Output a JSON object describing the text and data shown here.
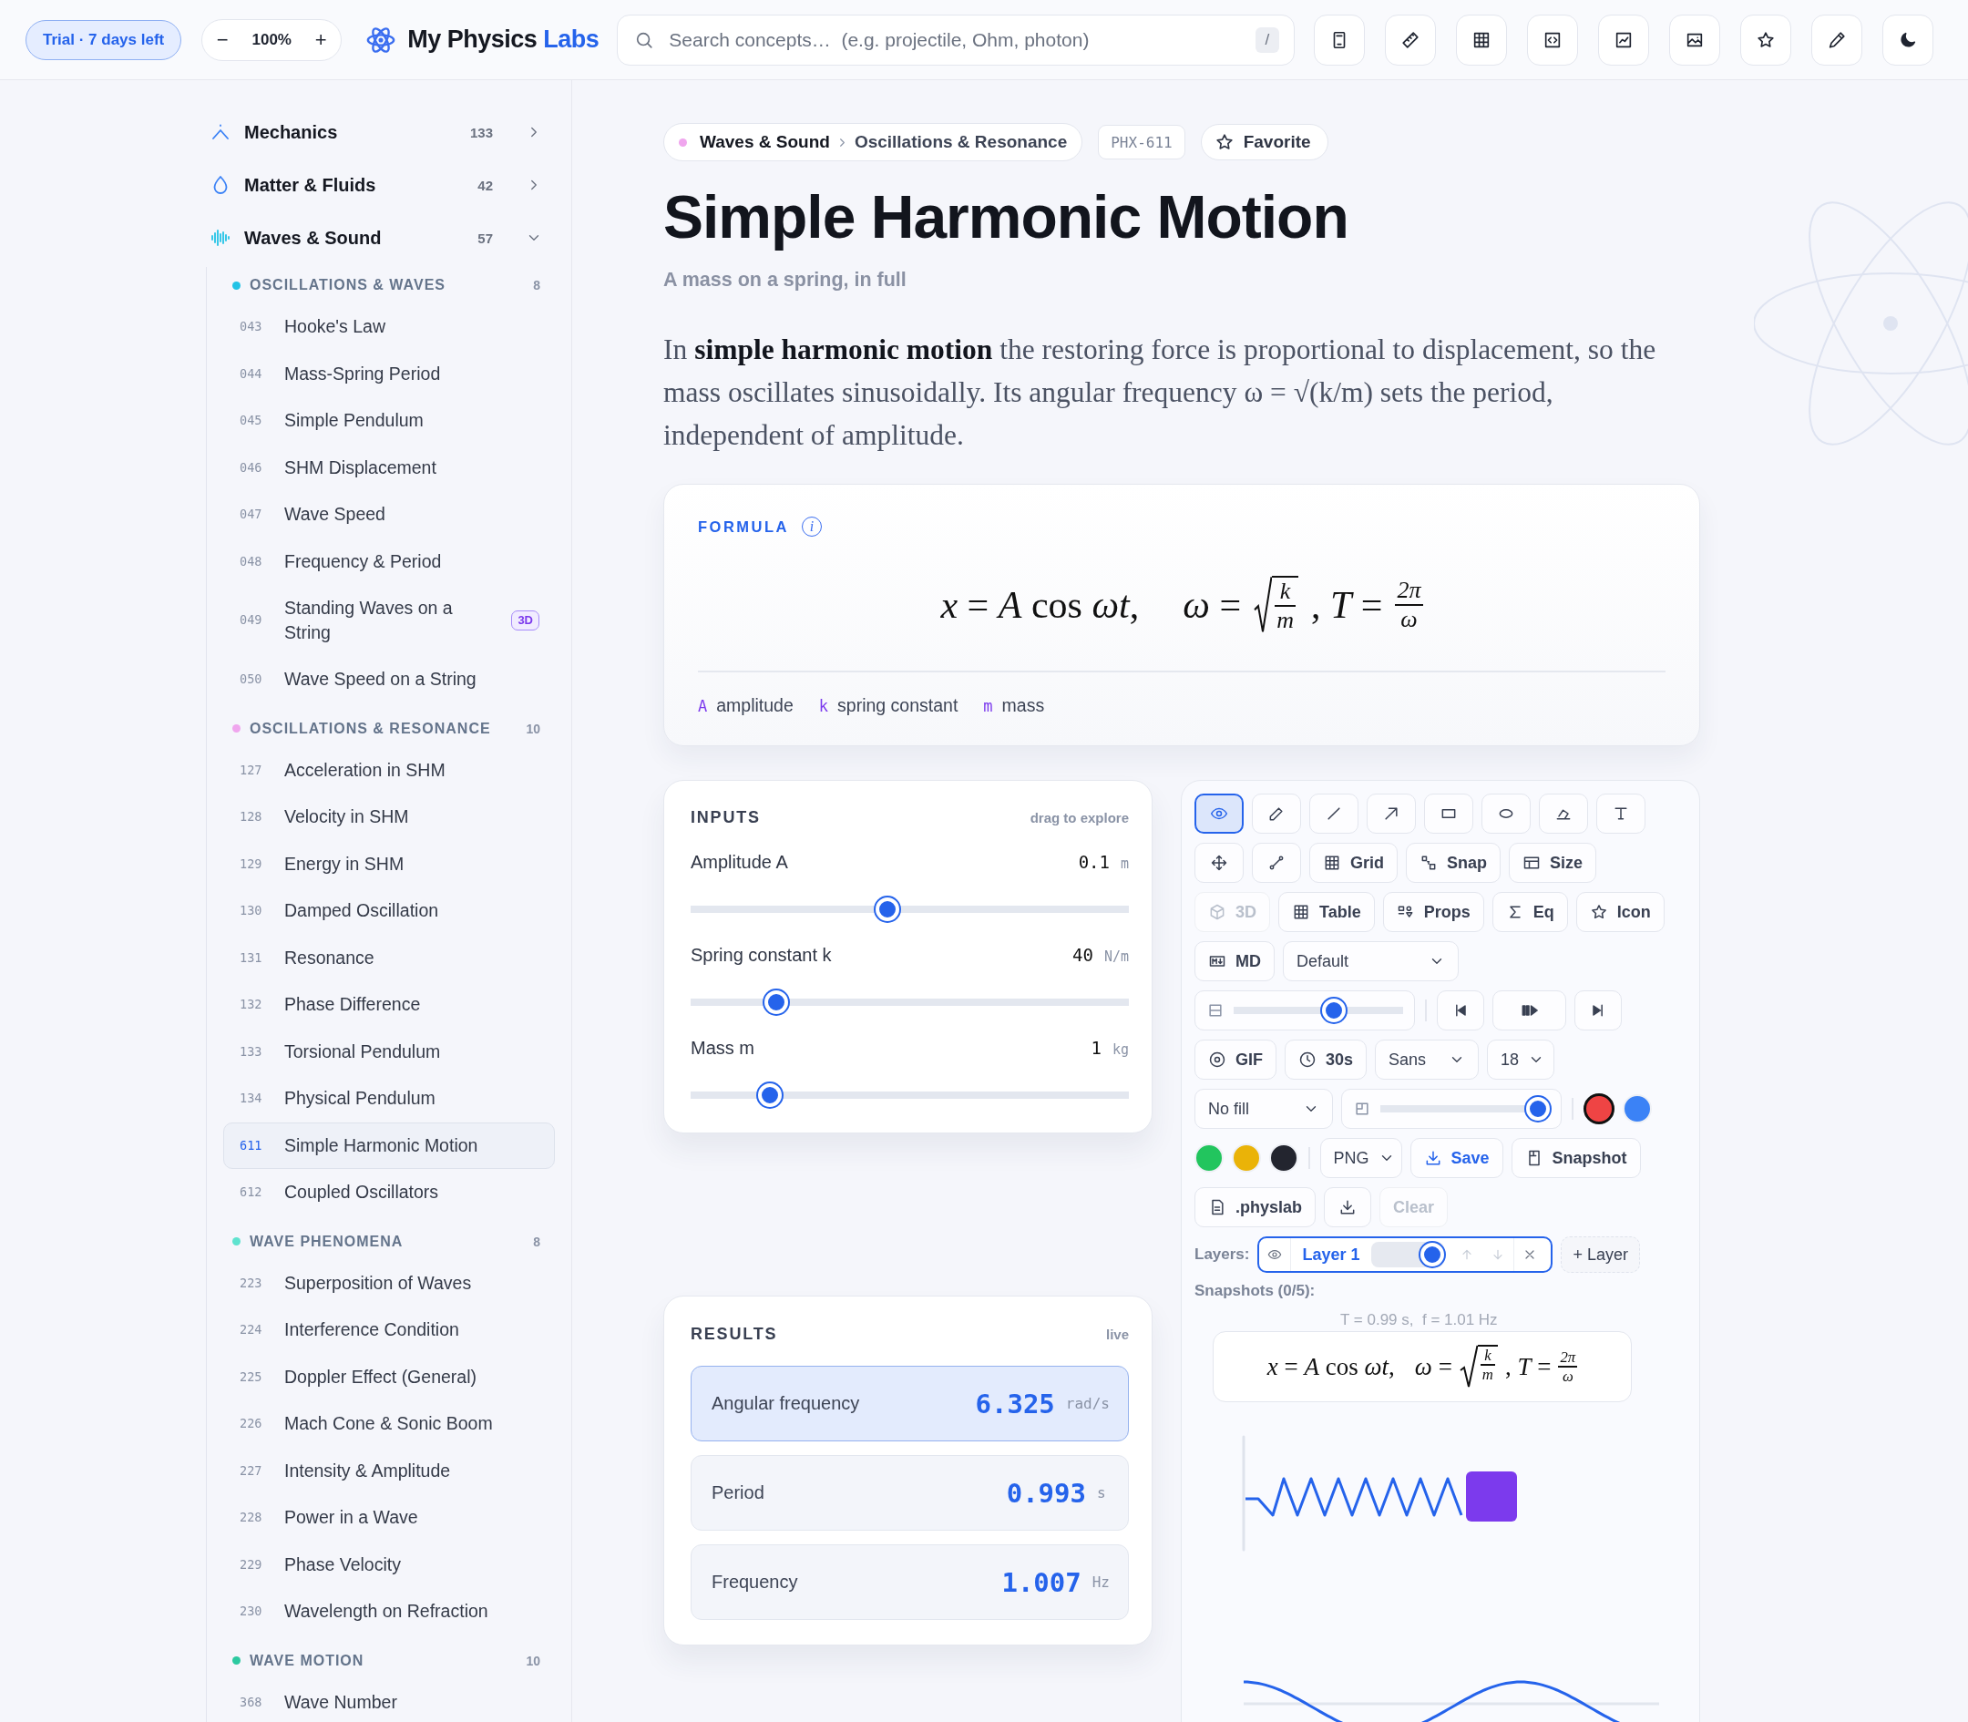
{
  "trial": "**Trial** · 7 days left",
  "zoom": {
    "minus": "−",
    "value": "100%",
    "plus": "+"
  },
  "brand": {
    "name": "My Physics",
    "accent": "Labs"
  },
  "search": {
    "placeholder": "Search concepts…  (e.g. projectile, Ohm, photon)",
    "shortcut": "/"
  },
  "sidebar": {
    "categories": [
      {
        "name": "Mechanics",
        "count": "133",
        "expanded": false
      },
      {
        "name": "Matter & Fluids",
        "count": "42",
        "expanded": false
      },
      {
        "name": "Waves & Sound",
        "count": "57",
        "expanded": true,
        "groups": [
          {
            "title": "OSCILLATIONS & WAVES",
            "count": "8",
            "color": "#22c3e6",
            "items": [
              {
                "num": "043",
                "title": "Hooke's Law",
                "selected": false
              },
              {
                "num": "044",
                "title": "Mass-Spring Period",
                "selected": false
              },
              {
                "num": "045",
                "title": "Simple Pendulum",
                "selected": false
              },
              {
                "num": "046",
                "title": "SHM Displacement",
                "selected": false
              },
              {
                "num": "047",
                "title": "Wave Speed",
                "selected": false
              },
              {
                "num": "048",
                "title": "Frequency & Period",
                "selected": false
              },
              {
                "num": "049",
                "title": "Standing Waves on a String",
                "badge": "3D",
                "selected": false
              },
              {
                "num": "050",
                "title": "Wave Speed on a String",
                "selected": false
              }
            ]
          },
          {
            "title": "OSCILLATIONS & RESONANCE",
            "count": "10",
            "color": "#f0a6ee",
            "items": [
              {
                "num": "127",
                "title": "Acceleration in SHM",
                "selected": false
              },
              {
                "num": "128",
                "title": "Velocity in SHM",
                "selected": false
              },
              {
                "num": "129",
                "title": "Energy in SHM",
                "selected": false
              },
              {
                "num": "130",
                "title": "Damped Oscillation",
                "selected": false
              },
              {
                "num": "131",
                "title": "Resonance",
                "selected": false
              },
              {
                "num": "132",
                "title": "Phase Difference",
                "selected": false
              },
              {
                "num": "133",
                "title": "Torsional Pendulum",
                "selected": false
              },
              {
                "num": "134",
                "title": "Physical Pendulum",
                "selected": false
              },
              {
                "num": "611",
                "title": "Simple Harmonic Motion",
                "selected": true
              },
              {
                "num": "612",
                "title": "Coupled Oscillators",
                "selected": false
              }
            ]
          },
          {
            "title": "WAVE PHENOMENA",
            "count": "8",
            "color": "#5fe3cf",
            "items": [
              {
                "num": "223",
                "title": "Superposition of Waves",
                "selected": false
              },
              {
                "num": "224",
                "title": "Interference Condition",
                "selected": false
              },
              {
                "num": "225",
                "title": "Doppler Effect (General)",
                "selected": false
              },
              {
                "num": "226",
                "title": "Mach Cone & Sonic Boom",
                "selected": false
              },
              {
                "num": "227",
                "title": "Intensity & Amplitude",
                "selected": false
              },
              {
                "num": "228",
                "title": "Power in a Wave",
                "selected": false
              },
              {
                "num": "229",
                "title": "Phase Velocity",
                "selected": false
              },
              {
                "num": "230",
                "title": "Wavelength on Refraction",
                "selected": false
              }
            ]
          },
          {
            "title": "WAVE MOTION",
            "count": "10",
            "color": "#2cc9a0",
            "items": [
              {
                "num": "368",
                "title": "Wave Number",
                "selected": false
              }
            ]
          }
        ]
      }
    ]
  },
  "breadcrumb": {
    "color": "#f0a6ee",
    "section": "Waves & Sound",
    "topic": "Oscillations & Resonance"
  },
  "code": "PHX-611",
  "favorite": {
    "label": "Favorite",
    "favorited": false
  },
  "title": "Simple Harmonic Motion",
  "subtitle": "A mass on a spring, in full",
  "intro": "In **simple harmonic motion** the restoring force is proportional to displacement, so the mass oscillates sinusoidally. Its angular frequency ω = √(k/m) sets the period, independent of amplitude.",
  "formula_card": {
    "label": "FORMULA",
    "info": "i",
    "formula": [
      {
        "kind": "text",
        "text": "*x* = *A* cos *ωt*,"
      },
      {
        "kind": "text",
        "text": "*ω* ="
      },
      {
        "kind": "sqrt",
        "num": "k",
        "den": "m"
      },
      {
        "kind": "text",
        "text": ", *T* ="
      },
      {
        "kind": "frac",
        "num": "2π",
        "den": "ω"
      }
    ],
    "legend": [
      {
        "symbol": "A",
        "meaning": "amplitude"
      },
      {
        "symbol": "k",
        "meaning": "spring constant"
      },
      {
        "symbol": "m",
        "meaning": "mass"
      }
    ]
  },
  "inputs": {
    "title": "INPUTS",
    "hint": "drag to explore",
    "sliders": [
      {
        "label": "Amplitude A",
        "value": "0.1",
        "unit": "m",
        "level": 0.45
      },
      {
        "label": "Spring constant k",
        "value": "40",
        "unit": "N/m",
        "level": 0.195
      },
      {
        "label": "Mass m",
        "value": "1",
        "unit": "kg",
        "level": 0.18
      }
    ]
  },
  "results": {
    "title": "RESULTS",
    "hint": "live",
    "rows": [
      {
        "label": "Angular frequency",
        "value": "6.325",
        "unit": "rad/s",
        "highlighted": true
      },
      {
        "label": "Period",
        "value": "0.993",
        "unit": "s",
        "highlighted": false
      },
      {
        "label": "Frequency",
        "value": "1.007",
        "unit": "Hz",
        "highlighted": false
      }
    ]
  },
  "toolbox": {
    "tools": [
      {
        "selected": true
      },
      {
        "selected": false
      },
      {
        "selected": false
      },
      {
        "selected": false
      },
      {
        "selected": false
      },
      {
        "selected": false
      },
      {
        "selected": false
      },
      {
        "selected": false
      }
    ],
    "row2": [
      {
        "label": "Grid",
        "disabled": false
      },
      {
        "label": "Snap",
        "disabled": false
      },
      {
        "label": "Size",
        "disabled": false
      }
    ],
    "row3": [
      {
        "label": "3D",
        "disabled": true
      },
      {
        "label": "Table",
        "disabled": false
      },
      {
        "label": "Props",
        "disabled": false
      },
      {
        "label": "Eq",
        "disabled": false
      },
      {
        "label": "Icon",
        "disabled": false
      }
    ],
    "md": "MD",
    "style_select": "Default",
    "playback_slider": {
      "level": 0.59
    },
    "record": "GIF",
    "duration": "30s",
    "font_select": "Sans",
    "size_select": "18",
    "fill_select": "No fill",
    "opacity": {
      "level": 0.93
    },
    "swatches": [
      {
        "color": "#ef4444",
        "selected": true
      },
      {
        "color": "#3b82f6",
        "selected": false
      },
      {
        "color": "#22c55e",
        "selected": false
      },
      {
        "color": "#eab308",
        "selected": false
      },
      {
        "color": "#23252f",
        "selected": false
      }
    ],
    "format_select": "PNG",
    "save": "Save",
    "snapshot": "Snapshot",
    "file": ".physlab",
    "clear": {
      "label": "Clear",
      "disabled": true
    },
    "layers": {
      "label": "Layers:",
      "items": [
        {
          "name": "Layer 1",
          "selected": true,
          "level": 0.84
        }
      ],
      "add": "+ Layer"
    },
    "snapshots_label": "Snapshots (0/5):",
    "readout": "T = 0.99 s,  f = 1.01 Hz",
    "snapshot_formula": [
      {
        "kind": "text",
        "text": "*x* = *A* cos *ωt*,"
      },
      {
        "kind": "text",
        "text": "*ω* ="
      },
      {
        "kind": "sqrt",
        "num": "k",
        "den": "m"
      },
      {
        "kind": "text",
        "text": ", *T* ="
      },
      {
        "kind": "frac",
        "num": "2π",
        "den": "ω"
      }
    ]
  }
}
